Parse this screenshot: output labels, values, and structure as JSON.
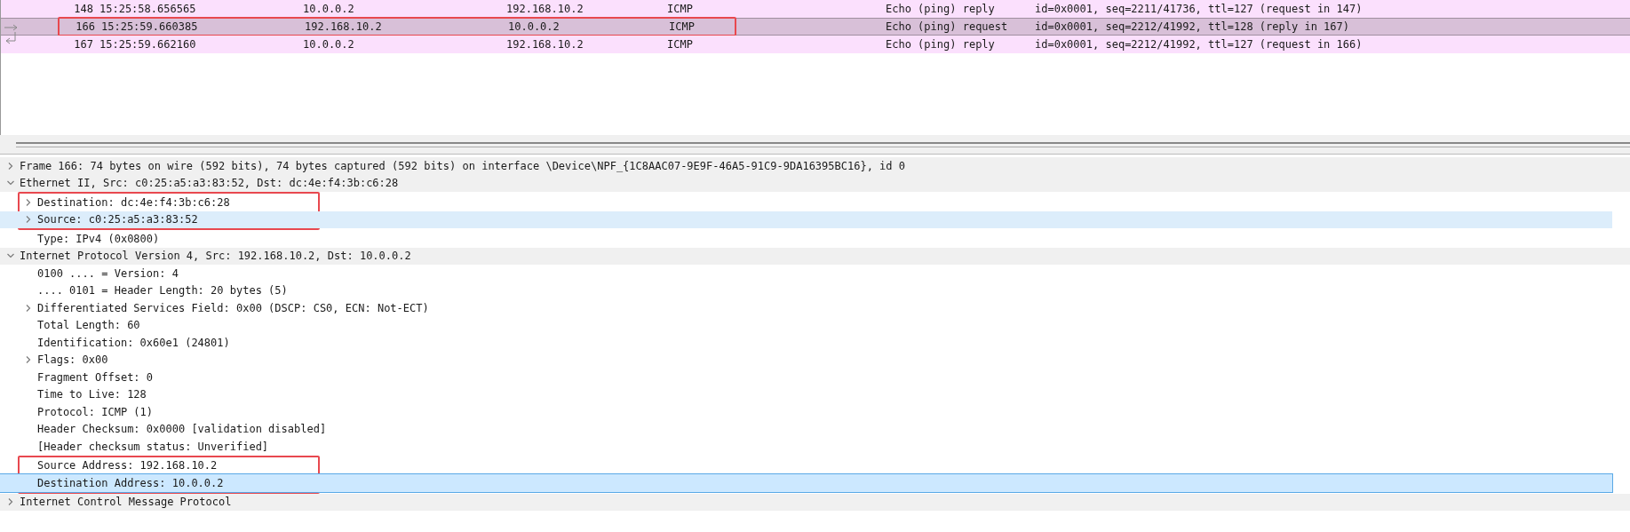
{
  "packets": [
    {
      "number": "148",
      "time": "15:25:58.656565",
      "source": "10.0.0.2",
      "destination": "192.168.10.2",
      "protocol": "ICMP",
      "info_type": "Echo (ping) reply",
      "info": "id=0x0001, seq=2211/41736, ttl=127 (request in 147)",
      "selected": false,
      "boxed": false,
      "kind": "plain"
    },
    {
      "number": "166",
      "time": "15:25:59.660385",
      "source": "192.168.10.2",
      "destination": "10.0.0.2",
      "protocol": "ICMP",
      "info_type": "Echo (ping) request",
      "info": "id=0x0001, seq=2212/41992, ttl=128 (reply in 167)",
      "selected": true,
      "boxed": true,
      "kind": "request"
    },
    {
      "number": "167",
      "time": "15:25:59.662160",
      "source": "10.0.0.2",
      "destination": "192.168.10.2",
      "protocol": "ICMP",
      "info_type": "Echo (ping) reply",
      "info": "id=0x0001, seq=2212/41992, ttl=127 (request in 166)",
      "selected": false,
      "boxed": false,
      "kind": "reply"
    }
  ],
  "details": [
    {
      "text": "Frame 166: 74 bytes on wire (592 bits), 74 bytes captured (592 bits) on interface \\Device\\NPF_{1C8AAC07-9E9F-46A5-91C9-9DA16395BC16}, id 0",
      "expanded": false,
      "selected": false,
      "hovered": false,
      "boxed": false
    },
    {
      "text": "Ethernet II, Src: c0:25:a5:a3:83:52, Dst: dc:4e:f4:3b:c6:28",
      "expanded": true,
      "selected": false,
      "hovered": false,
      "boxed": false,
      "children": [
        {
          "text": "Destination: dc:4e:f4:3b:c6:28",
          "expanded": false,
          "selected": false,
          "hovered": false,
          "boxed": true
        },
        {
          "text": "Source: c0:25:a5:a3:83:52",
          "expanded": false,
          "selected": false,
          "hovered": true,
          "boxed": true
        },
        {
          "text": "Type: IPv4 (0x0800)",
          "selected": false,
          "hovered": false,
          "boxed": false
        }
      ]
    },
    {
      "text": "Internet Protocol Version 4, Src: 192.168.10.2, Dst: 10.0.0.2",
      "expanded": true,
      "selected": false,
      "hovered": false,
      "boxed": false,
      "children": [
        {
          "text": "0100 .... = Version: 4",
          "selected": false,
          "hovered": false,
          "boxed": false
        },
        {
          "text": ".... 0101 = Header Length: 20 bytes (5)",
          "selected": false,
          "hovered": false,
          "boxed": false
        },
        {
          "text": "Differentiated Services Field: 0x00 (DSCP: CS0, ECN: Not-ECT)",
          "expanded": false,
          "selected": false,
          "hovered": false,
          "boxed": false
        },
        {
          "text": "Total Length: 60",
          "selected": false,
          "hovered": false,
          "boxed": false
        },
        {
          "text": "Identification: 0x60e1 (24801)",
          "selected": false,
          "hovered": false,
          "boxed": false
        },
        {
          "text": "Flags: 0x00",
          "expanded": false,
          "selected": false,
          "hovered": false,
          "boxed": false
        },
        {
          "text": "Fragment Offset: 0",
          "selected": false,
          "hovered": false,
          "boxed": false
        },
        {
          "text": "Time to Live: 128",
          "selected": false,
          "hovered": false,
          "boxed": false
        },
        {
          "text": "Protocol: ICMP (1)",
          "selected": false,
          "hovered": false,
          "boxed": false
        },
        {
          "text": "Header Checksum: 0x0000 [validation disabled]",
          "selected": false,
          "hovered": false,
          "boxed": false
        },
        {
          "text": "[Header checksum status: Unverified]",
          "selected": false,
          "hovered": false,
          "boxed": false
        },
        {
          "text": "Source Address: 192.168.10.2",
          "selected": false,
          "hovered": false,
          "boxed": true
        },
        {
          "text": "Destination Address: 10.0.0.2",
          "selected": true,
          "hovered": false,
          "boxed": true
        }
      ]
    },
    {
      "text": "Internet Control Message Protocol",
      "expanded": false,
      "selected": false,
      "hovered": false,
      "boxed": false
    }
  ]
}
